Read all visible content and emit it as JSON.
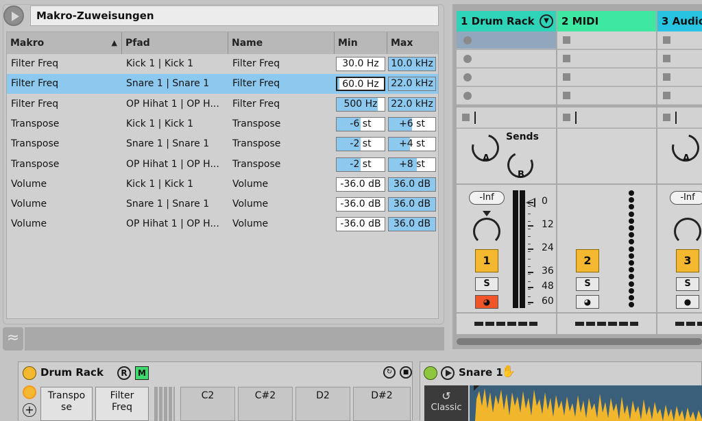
{
  "macro_panel": {
    "title": "Makro-Zuweisungen",
    "columns": {
      "makro": "Makro",
      "pfad": "Pfad",
      "name": "Name",
      "min": "Min",
      "max": "Max"
    },
    "rows": [
      {
        "makro": "Filter Freq",
        "pfad": "Kick 1 | Kick 1",
        "name": "Filter Freq",
        "min": "30.0 Hz",
        "max": "10.0 kHz",
        "min_fill": 0.0,
        "max_fill": 1.0
      },
      {
        "makro": "Filter Freq",
        "pfad": "Snare 1 | Snare 1",
        "name": "Filter Freq",
        "min": "60.0 Hz",
        "max": "22.0 kHz",
        "min_fill": 0.05,
        "max_fill": 1.0
      },
      {
        "makro": "Filter Freq",
        "pfad": "OP Hihat 1 | OP H...",
        "name": "Filter Freq",
        "min": "500 Hz",
        "max": "22.0 kHz",
        "min_fill": 0.85,
        "max_fill": 1.0
      },
      {
        "makro": "Transpose",
        "pfad": "Kick 1 | Kick 1",
        "name": "Transpose",
        "min": "-6 st",
        "max": "+6 st",
        "min_fill": 0.5,
        "max_fill": 0.5
      },
      {
        "makro": "Transpose",
        "pfad": "Snare 1 | Snare 1",
        "name": "Transpose",
        "min": "-2 st",
        "max": "+4 st",
        "min_fill": 0.5,
        "max_fill": 0.45
      },
      {
        "makro": "Transpose",
        "pfad": "OP Hihat 1 | OP H...",
        "name": "Transpose",
        "min": "-2 st",
        "max": "+8 st",
        "min_fill": 0.5,
        "max_fill": 0.6
      },
      {
        "makro": "Volume",
        "pfad": "Kick 1 | Kick 1",
        "name": "Volume",
        "min": "-36.0 dB",
        "max": "36.0 dB",
        "min_fill": 0.0,
        "max_fill": 1.0
      },
      {
        "makro": "Volume",
        "pfad": "Snare 1 | Snare 1",
        "name": "Volume",
        "min": "-36.0 dB",
        "max": "36.0 dB",
        "min_fill": 0.0,
        "max_fill": 1.0
      },
      {
        "makro": "Volume",
        "pfad": "OP Hihat 1 | OP H...",
        "name": "Volume",
        "min": "-36.0 dB",
        "max": "36.0 dB",
        "min_fill": 0.0,
        "max_fill": 1.0
      }
    ],
    "selected_row": 1
  },
  "session": {
    "tracks": [
      {
        "label": "1 Drum Rack",
        "color": "#2fd3b7"
      },
      {
        "label": "2 MIDI",
        "color": "#3fe8a2"
      },
      {
        "label": "3 Audio",
        "color": "#27c3e0"
      }
    ],
    "sends_label": "Sends",
    "send_a": "A",
    "send_b": "B",
    "volume_inf": "-Inf",
    "track_numbers": [
      "1",
      "2",
      "3"
    ],
    "solo": "S",
    "meter_ticks": [
      "0",
      "12",
      "24",
      "36",
      "48",
      "60"
    ]
  },
  "device": {
    "title": "Drum Rack",
    "r_label": "R",
    "m_label": "M",
    "macro_buttons": [
      "Transpo se",
      "Filter Freq"
    ],
    "pads": [
      "C2",
      "C#2",
      "D2",
      "D#2"
    ]
  },
  "sample": {
    "title": "Snare 1",
    "mode": "Classic"
  }
}
